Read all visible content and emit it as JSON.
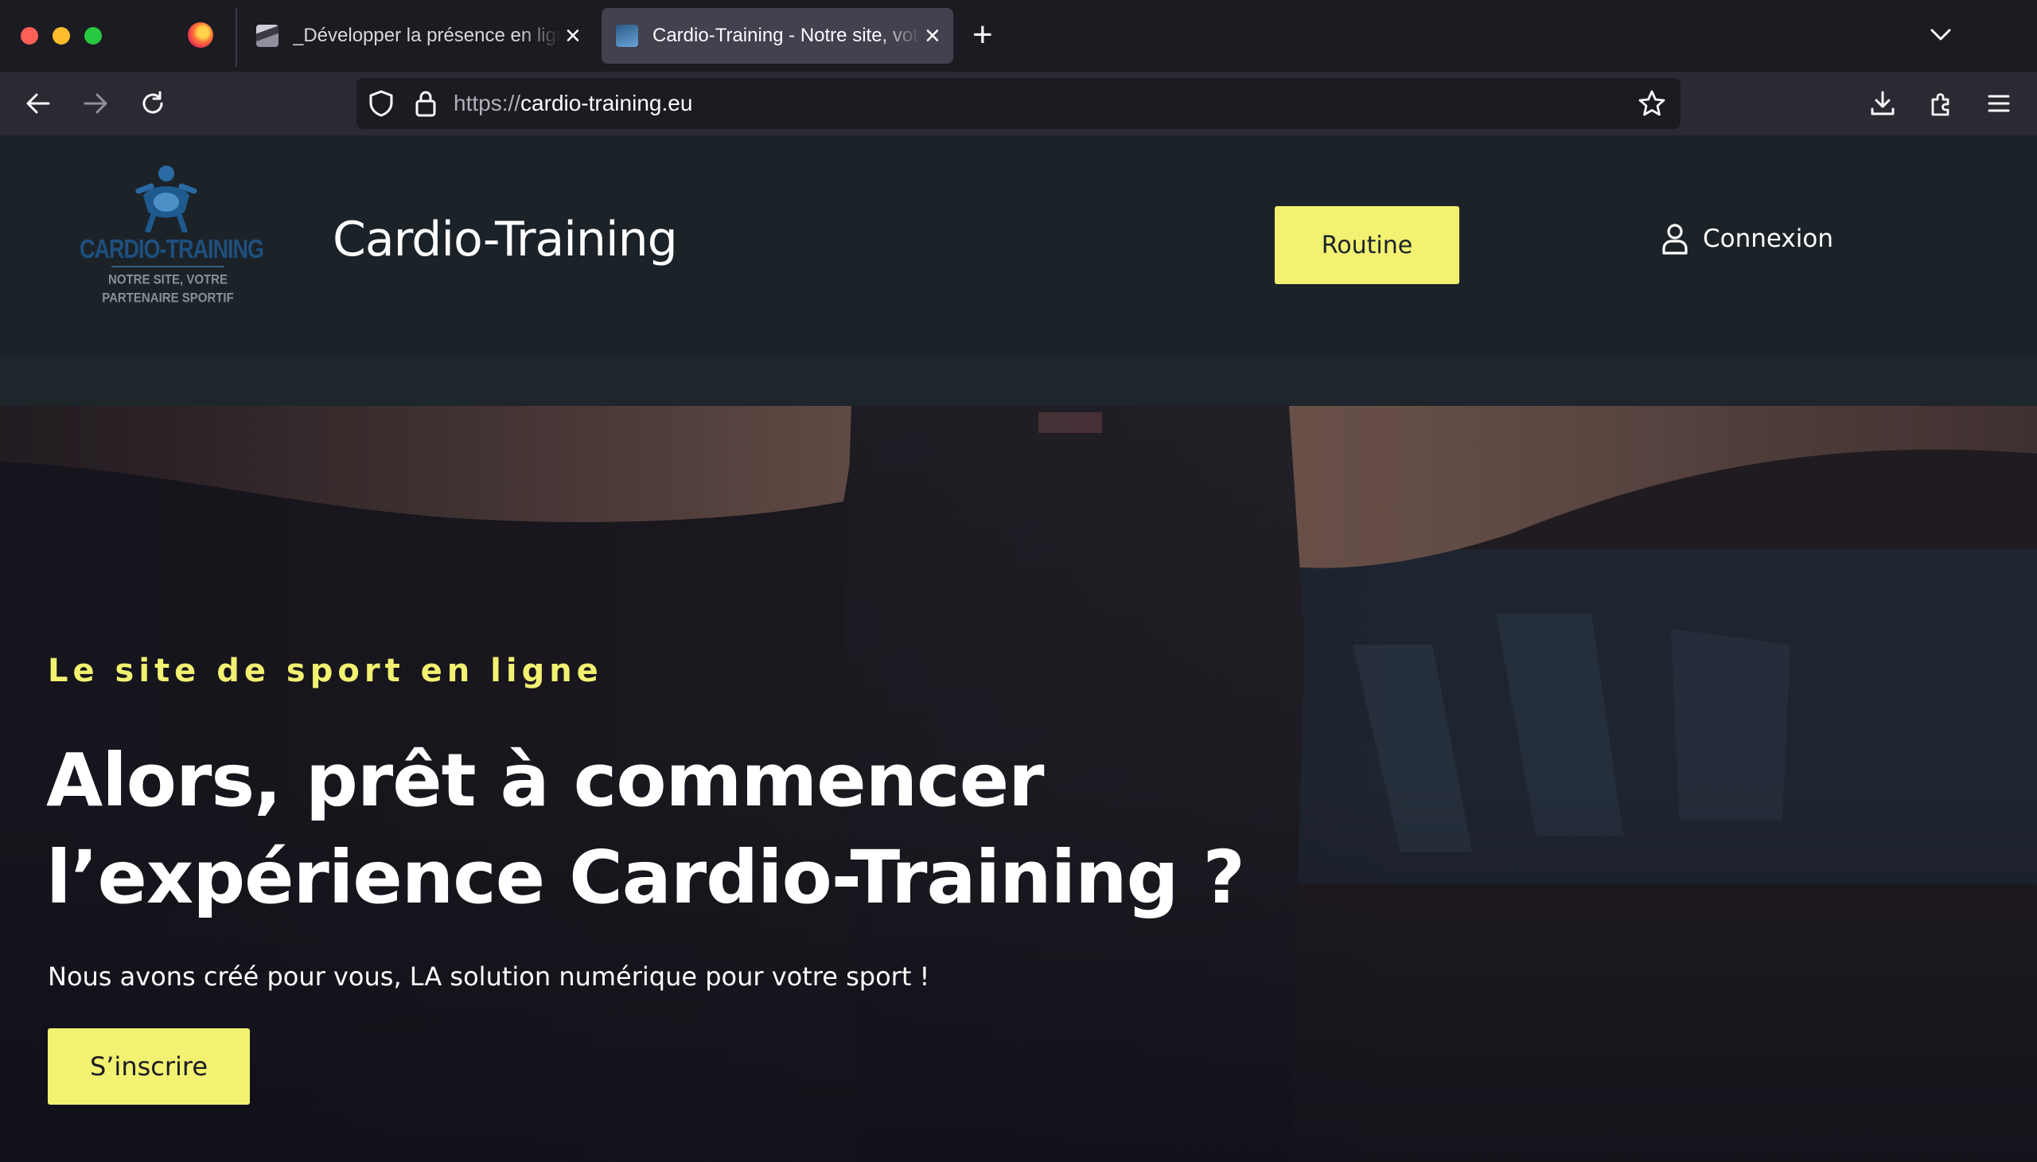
{
  "browser": {
    "tabs": [
      {
        "title": "_Développer la présence en ligne",
        "active": false
      },
      {
        "title": "Cardio-Training - Notre site, votre partenaire sportif",
        "active": true
      }
    ],
    "url": {
      "scheme": "https://",
      "host": "cardio-training.eu"
    },
    "icons": [
      "firefox-logo",
      "close-icon",
      "plus-icon",
      "chevron-down-icon",
      "arrow-left-icon",
      "arrow-right-icon",
      "reload-icon",
      "shield-icon",
      "lock-icon",
      "star-icon",
      "download-icon",
      "puzzle-icon",
      "hamburger-icon"
    ]
  },
  "site": {
    "logo": {
      "title": "CARDIO-TRAINING",
      "subtitle": "NOTRE SITE, VOTRE PARTENAIRE SPORTIF"
    },
    "title": "Cardio-Training",
    "nav": {
      "routine_label": "Routine",
      "connexion_label": "Connexion"
    },
    "hero": {
      "kicker": "Le site de sport en ligne",
      "heading": "Alors, prêt à commencer l’expérience Cardio-Training ?",
      "subtitle": "Nous avons créé pour vous, LA solution numérique pour votre sport !",
      "cta_label": "S’inscrire"
    }
  },
  "colors": {
    "accent": "#f2f171",
    "header_bg": "#1b2329",
    "browser_chrome": "#1c1b22",
    "toolbar": "#2b2a33",
    "logo_blue": "#1f4f7d"
  }
}
